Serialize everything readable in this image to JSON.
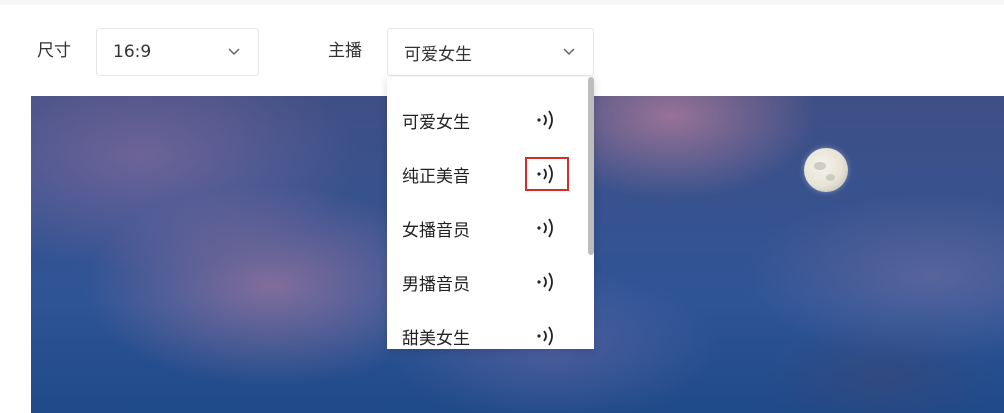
{
  "size_control": {
    "label": "尺寸",
    "value": "16:9",
    "chevron_icon": "chevron-down-icon"
  },
  "anchor_control": {
    "label": "主播",
    "value": "可爱女生",
    "chevron_icon": "chevron-down-icon"
  },
  "anchor_dropdown": {
    "options": [
      {
        "label": "可爱女生",
        "play_icon": "audio-wave-icon"
      },
      {
        "label": "纯正美音",
        "play_icon": "audio-wave-icon",
        "highlighted": true
      },
      {
        "label": "女播音员",
        "play_icon": "audio-wave-icon"
      },
      {
        "label": "男播音员",
        "play_icon": "audio-wave-icon"
      },
      {
        "label": "甜美女生",
        "play_icon": "audio-wave-icon"
      }
    ]
  },
  "preview": {
    "description_icon": "moon-icon"
  },
  "colors": {
    "border": "#e4e6eb",
    "highlight": "#d62c2c",
    "text": "#333333"
  }
}
